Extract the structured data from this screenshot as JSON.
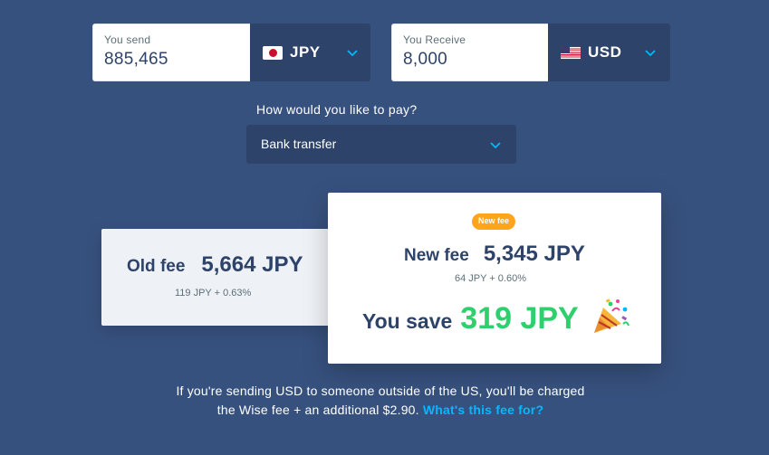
{
  "send": {
    "label": "You send",
    "amount": "885,465",
    "currency": "JPY",
    "flag_icon": "japan-flag-icon"
  },
  "receive": {
    "label": "You Receive",
    "amount": "8,000",
    "currency": "USD",
    "flag_icon": "us-flag-icon"
  },
  "payment": {
    "question": "How would you like to pay?",
    "selected": "Bank transfer"
  },
  "old_fee": {
    "title": "Old fee",
    "amount": "5,664 JPY",
    "breakdown": "119 JPY + 0.63%"
  },
  "new_fee": {
    "badge": "New fee",
    "title": "New fee",
    "amount": "5,345 JPY",
    "breakdown": "64 JPY + 0.60%",
    "save_label": "You save",
    "save_amount": "319 JPY",
    "celebration_icon": "party-popper-icon"
  },
  "footer": {
    "line1": "If you're sending USD to someone outside of the US, you'll be charged",
    "line2": "the Wise fee + an additional $2.90.",
    "link": "What's this fee for?"
  },
  "colors": {
    "background": "#37517e",
    "dark_panel": "#2e4369",
    "save_green": "#2ed06e",
    "badge_orange": "#ffa41c",
    "link_blue": "#00b9ff"
  }
}
